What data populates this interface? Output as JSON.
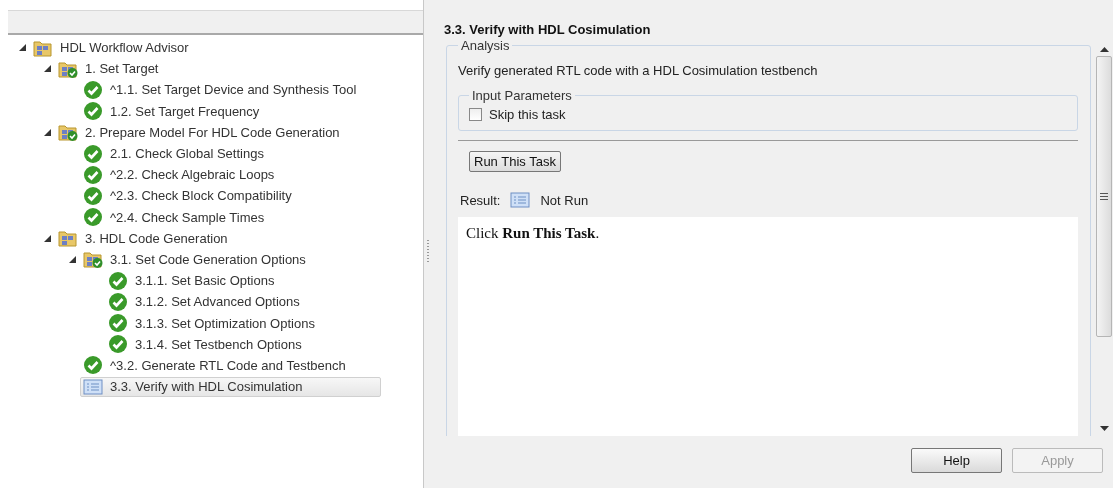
{
  "tree": {
    "items": [
      {
        "label": "HDL Workflow Advisor",
        "kind": "folder",
        "expanded": true,
        "selected": false,
        "children": [
          {
            "label": "1. Set Target",
            "kind": "folder-passed",
            "expanded": true,
            "selected": false,
            "children": [
              {
                "label": "^1.1. Set Target Device and Synthesis Tool",
                "kind": "passed",
                "selected": false
              },
              {
                "label": "1.2. Set Target Frequency",
                "kind": "passed",
                "selected": false
              }
            ]
          },
          {
            "label": "2. Prepare Model For HDL Code Generation",
            "kind": "folder-passed",
            "expanded": true,
            "selected": false,
            "children": [
              {
                "label": "2.1. Check Global Settings",
                "kind": "passed",
                "selected": false
              },
              {
                "label": "^2.2. Check Algebraic Loops",
                "kind": "passed",
                "selected": false
              },
              {
                "label": "^2.3. Check Block Compatibility",
                "kind": "passed",
                "selected": false
              },
              {
                "label": "^2.4. Check Sample Times",
                "kind": "passed",
                "selected": false
              }
            ]
          },
          {
            "label": "3. HDL Code Generation",
            "kind": "folder",
            "expanded": true,
            "selected": false,
            "children": [
              {
                "label": "3.1. Set Code Generation Options",
                "kind": "folder-passed",
                "expanded": true,
                "selected": false,
                "children": [
                  {
                    "label": "3.1.1. Set Basic Options",
                    "kind": "passed",
                    "selected": false
                  },
                  {
                    "label": "3.1.2. Set Advanced Options",
                    "kind": "passed",
                    "selected": false
                  },
                  {
                    "label": "3.1.3. Set Optimization Options",
                    "kind": "passed",
                    "selected": false
                  },
                  {
                    "label": "3.1.4. Set Testbench Options",
                    "kind": "passed",
                    "selected": false
                  }
                ]
              },
              {
                "label": "^3.2. Generate RTL Code and Testbench",
                "kind": "passed",
                "selected": false
              },
              {
                "label": "3.3. Verify with HDL Cosimulation",
                "kind": "task",
                "selected": true
              }
            ]
          }
        ]
      }
    ]
  },
  "task": {
    "title": "3.3. Verify with HDL Cosimulation",
    "analysis": {
      "legend": "Analysis",
      "description": "Verify generated RTL code with a HDL Cosimulation testbench",
      "input_parameters": {
        "legend": "Input Parameters",
        "options": [
          {
            "label": "Skip this task",
            "checked": false
          }
        ]
      },
      "run_button": "Run This Task",
      "result_label": "Result:",
      "result": "Not Run",
      "report": "Click **Run This Task**."
    }
  },
  "buttons": [
    {
      "label": "Help",
      "disabled": false
    },
    {
      "label": "Apply",
      "disabled": true
    }
  ]
}
